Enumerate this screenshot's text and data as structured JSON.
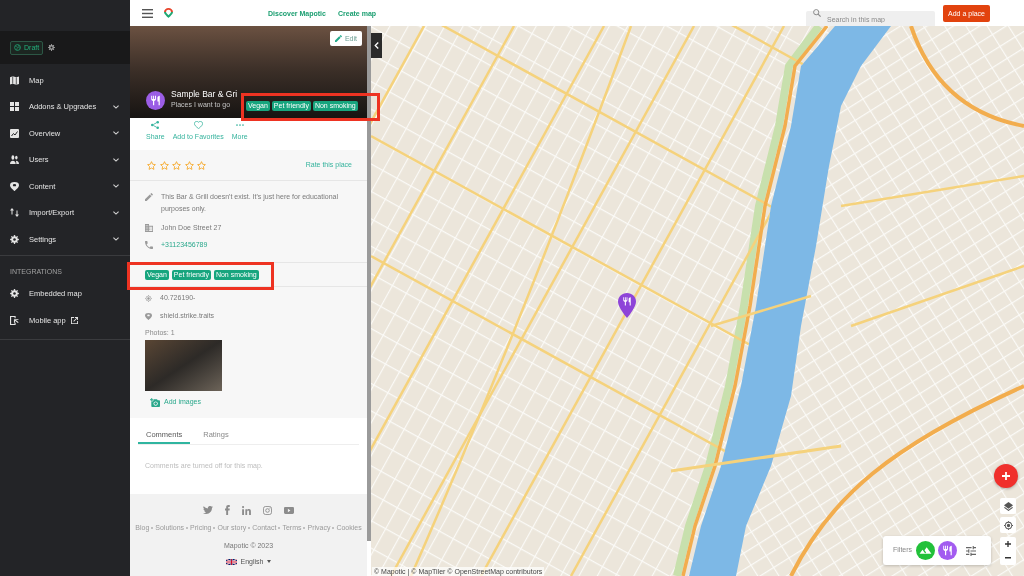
{
  "sidebar": {
    "status_badge": "Draft",
    "nav_items": [
      {
        "label": "Map",
        "expandable": false
      },
      {
        "label": "Addons & Upgrades",
        "expandable": true
      },
      {
        "label": "Overview",
        "expandable": true
      },
      {
        "label": "Users",
        "expandable": true
      },
      {
        "label": "Content",
        "expandable": true
      },
      {
        "label": "Import/Export",
        "expandable": true
      },
      {
        "label": "Settings",
        "expandable": true
      }
    ],
    "section_title": "INTEGRATIONS",
    "integration_items": [
      {
        "label": "Embedded map",
        "external": false
      },
      {
        "label": "Mobile app",
        "external": true
      }
    ]
  },
  "top_bar": {
    "links": [
      "Discover Mapotic",
      "Create map"
    ],
    "search": {
      "placeholder": "Search in this map"
    },
    "add_button": "Add a place"
  },
  "place": {
    "edit_button": "Edit",
    "title": "Sample Bar & Gri",
    "subtitle": "Places I want to go",
    "header_tags": [
      "Vegan",
      "Pet friendly",
      "Non smoking"
    ],
    "actions": [
      "Share",
      "Add to Favorites",
      "More"
    ],
    "stars": 0,
    "rate_link": "Rate this place",
    "details": [
      {
        "kind": "description",
        "text": "This Bar & Grill doesn't exist. It's just here for educational purposes only."
      },
      {
        "kind": "address",
        "text": "John Doe Street 27"
      },
      {
        "kind": "phone",
        "text": "+31123456789"
      }
    ],
    "tags": [
      "Vegan",
      "Pet friendly",
      "Non smoking"
    ],
    "location": [
      {
        "kind": "coordinates",
        "text": "40.726190-"
      },
      {
        "kind": "words",
        "text": "shield.strike.traits"
      }
    ],
    "photos_label": "Photos: 1",
    "add_images": "Add images"
  },
  "tabs": [
    {
      "label": "Comments",
      "selected": true
    },
    {
      "label": "Ratings",
      "selected": false
    }
  ],
  "comments_note": "Comments are turned off for this map.",
  "footer": {
    "links": [
      "Blog",
      "Solutions",
      "Pricing",
      "Our story",
      "Contact",
      "Terms",
      "Privacy",
      "Cookies"
    ],
    "copyright": "Mapotic © 2023",
    "language": "English"
  },
  "map": {
    "filters_label": "Filters",
    "filters": [
      {
        "color": "#22c13a"
      },
      {
        "color": "#a35cf0"
      }
    ],
    "attribution": "© Mapotic | © MapTiler © OpenStreetMap contributors"
  }
}
